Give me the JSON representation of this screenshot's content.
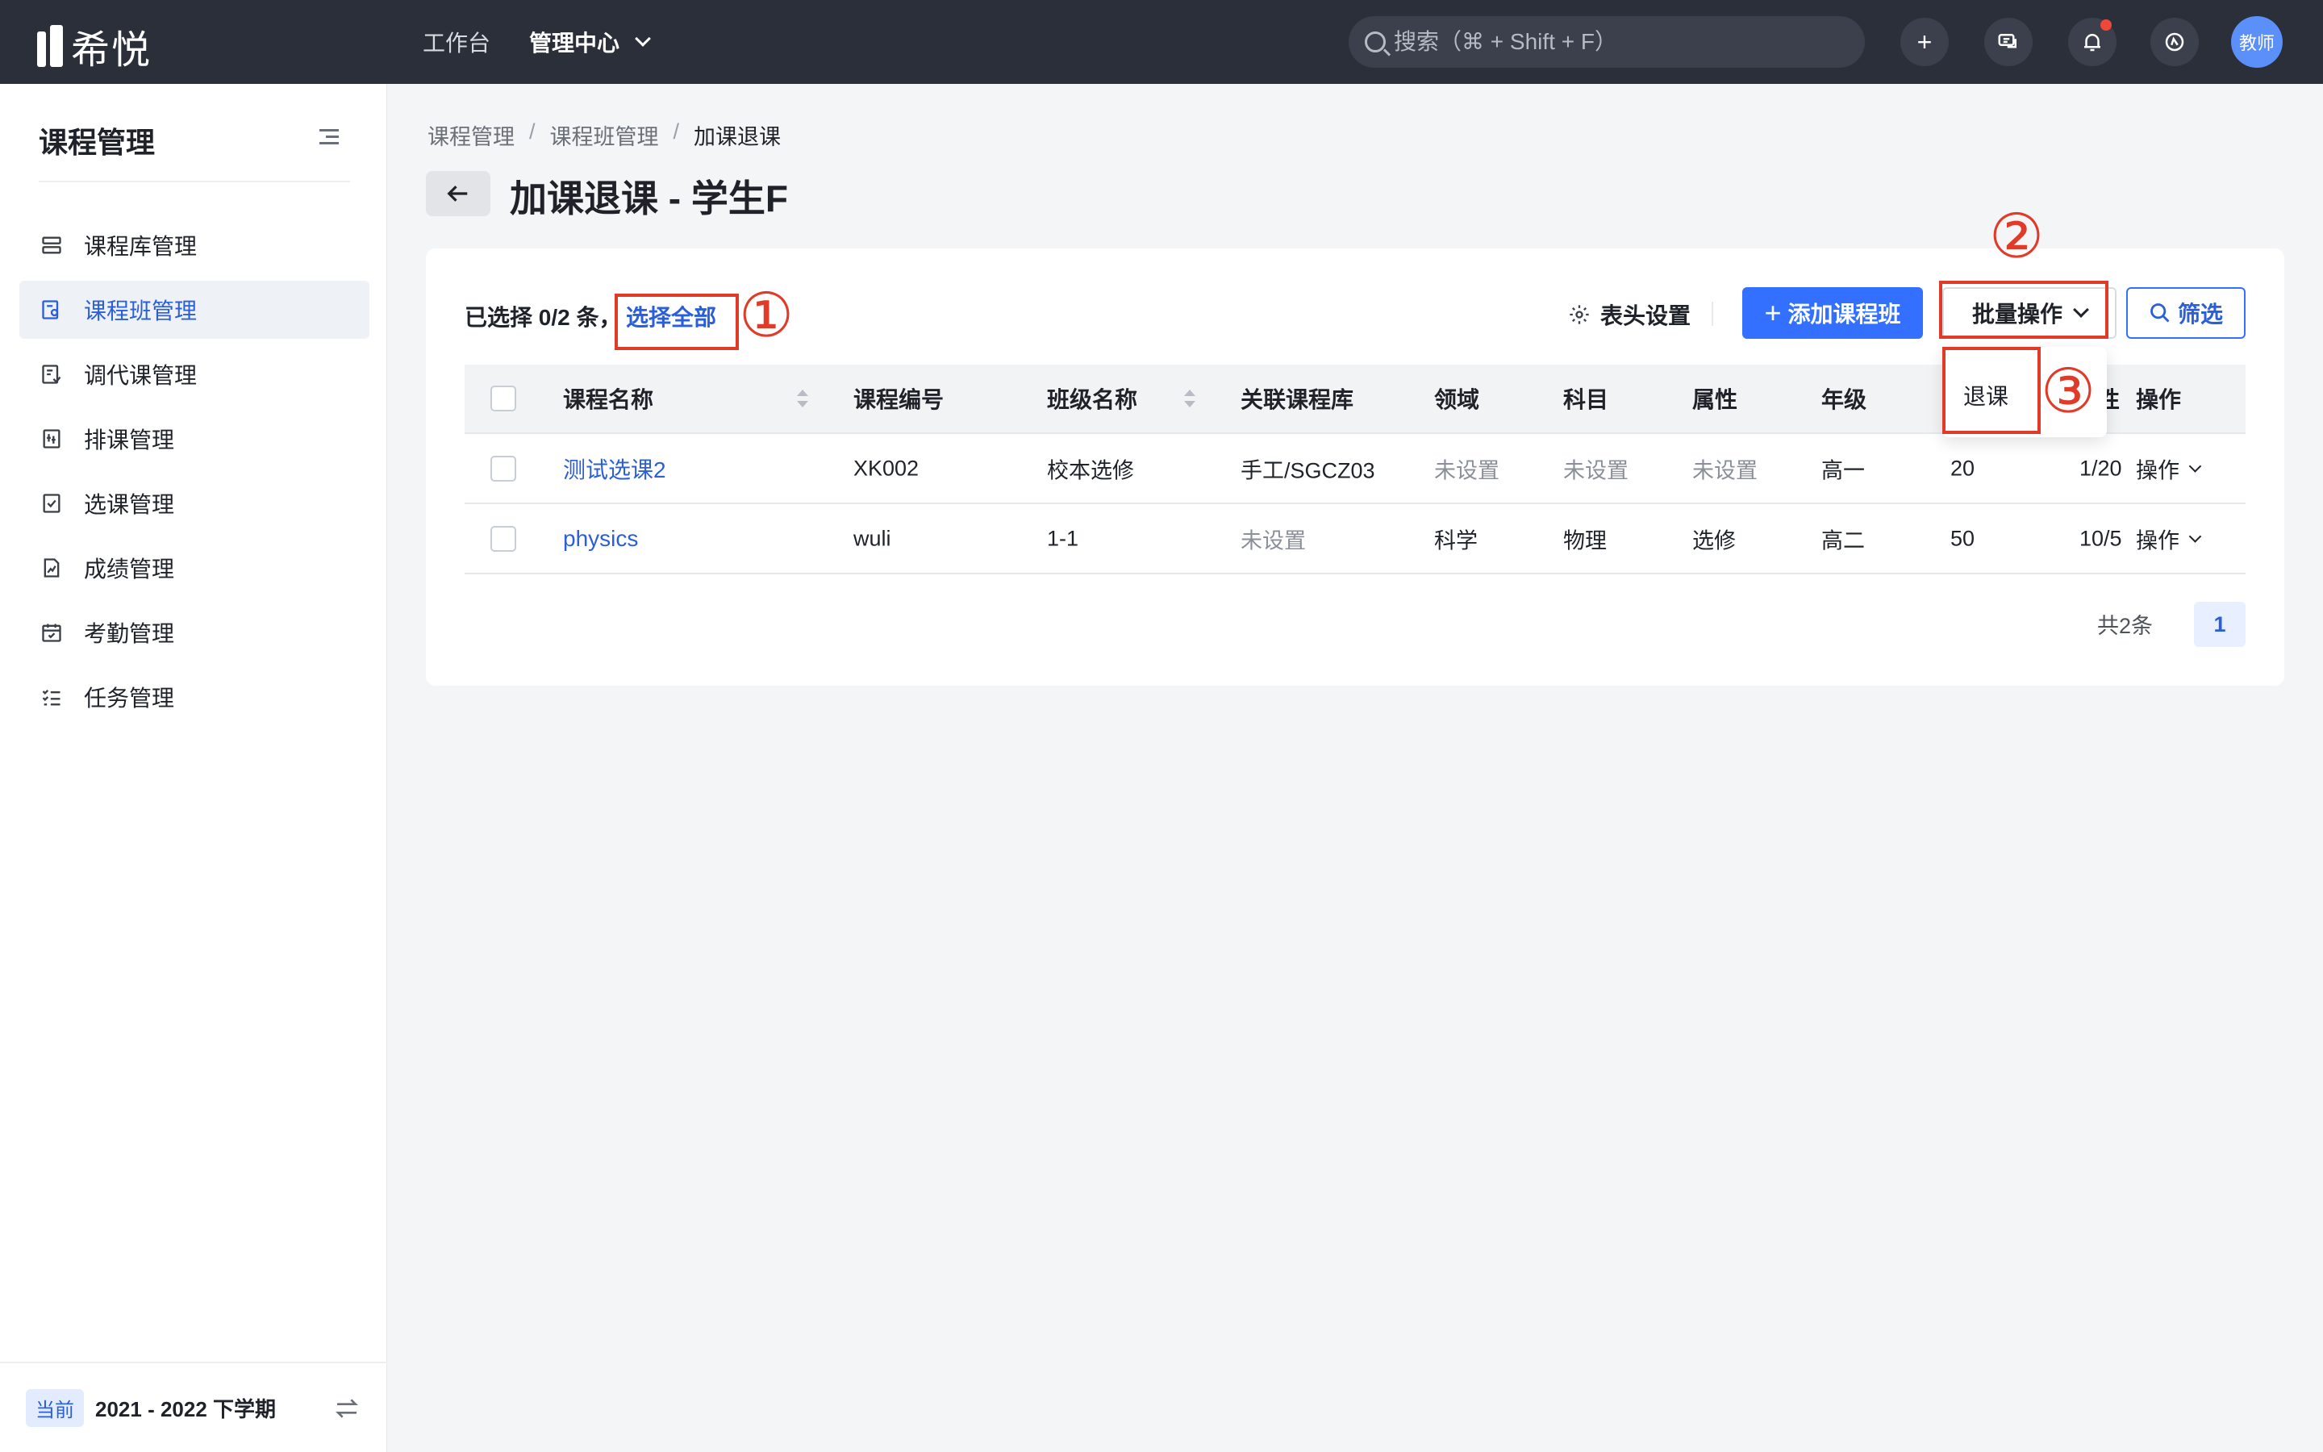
{
  "app": {
    "logo_text": "希悦"
  },
  "topnav": {
    "items": [
      {
        "label": "工作台"
      },
      {
        "label": "管理中心"
      }
    ],
    "search_placeholder": "搜索（⌘ + Shift + F）",
    "add_glyph": "+",
    "avatar_label": "教师"
  },
  "sidebar": {
    "title": "课程管理",
    "items": [
      {
        "label": "课程库管理",
        "icon": "course-library-icon"
      },
      {
        "label": "课程班管理",
        "icon": "course-class-icon",
        "active": true
      },
      {
        "label": "调代课管理",
        "icon": "substitute-icon"
      },
      {
        "label": "排课管理",
        "icon": "schedule-icon"
      },
      {
        "label": "选课管理",
        "icon": "course-select-icon"
      },
      {
        "label": "成绩管理",
        "icon": "grades-icon"
      },
      {
        "label": "考勤管理",
        "icon": "attendance-icon"
      },
      {
        "label": "任务管理",
        "icon": "tasks-icon"
      }
    ],
    "footer": {
      "badge": "当前",
      "term": "2021 - 2022 下学期"
    }
  },
  "breadcrumb": [
    "课程管理",
    "课程班管理",
    "加课退课"
  ],
  "breadcrumb_sep": "/",
  "page": {
    "title": "加课退课 - 学生F"
  },
  "toolbar": {
    "selection": "已选择 0/2 条，",
    "select_all": "选择全部",
    "column_settings": "表头设置",
    "add_class": "添加课程班",
    "add_glyph": "+",
    "batch": "批量操作",
    "filter": "筛选"
  },
  "table": {
    "headers": [
      "课程名称",
      "课程编号",
      "班级名称",
      "关联课程库",
      "领域",
      "科目",
      "属性",
      "年级",
      "",
      "操作"
    ],
    "header_fragment": "性",
    "rows": [
      {
        "name": "测试选课2",
        "code": "XK002",
        "class": "校本选修",
        "library": "手工/SGCZ03",
        "field": "未设置",
        "subject": "未设置",
        "attr": "未设置",
        "grade": "高一",
        "capacity": "20",
        "extra": "1/20",
        "op": "操作"
      },
      {
        "name": "physics",
        "code": "wuli",
        "class": "1-1",
        "library": "未设置",
        "field": "科学",
        "subject": "物理",
        "attr": "选修",
        "grade": "高二",
        "capacity": "50",
        "extra": "10/5",
        "op": "操作"
      }
    ]
  },
  "pagination": {
    "total": "共2条",
    "page": "1"
  },
  "dropdown": {
    "items": [
      "退课"
    ]
  },
  "annotations": [
    "①",
    "②",
    "③"
  ],
  "colors": {
    "primary": "#3370ff",
    "annotation": "#e03a28",
    "topbar": "#2b2f3a"
  }
}
